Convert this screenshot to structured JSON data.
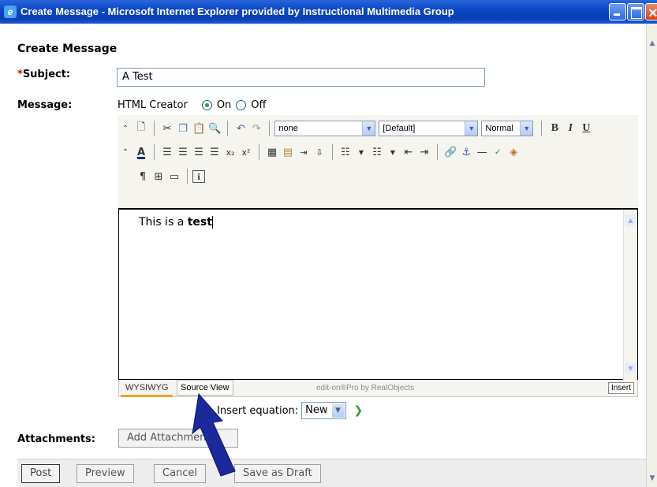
{
  "window": {
    "title": "Create Message - Microsoft Internet Explorer provided by Instructional Multimedia Group"
  },
  "form": {
    "heading": "Create Message",
    "subject_required_mark": "*",
    "subject_label": "Subject:",
    "subject_value": "A Test",
    "message_label": "Message:",
    "html_creator_label": "HTML Creator",
    "on_label": "On",
    "off_label": "Off",
    "html_creator_on": true
  },
  "toolbar": {
    "style_select": "none",
    "font_select": "[Default]",
    "size_select": "Normal",
    "bold": "B",
    "italic": "I",
    "underline": "U"
  },
  "editor": {
    "text_normal": "This is a ",
    "text_bold": "test",
    "tab_wysiwyg": "WYSIWYG",
    "tab_source": "Source View",
    "brand": "edit-on®Pro by RealObjects",
    "insert_mode": "Insert"
  },
  "equation": {
    "label": "Insert equation:",
    "value": "New"
  },
  "attachments": {
    "label": "Attachments:",
    "button": "Add Attachment"
  },
  "buttons": {
    "post": "Post",
    "preview": "Preview",
    "cancel": "Cancel",
    "save_draft": "Save as Draft"
  },
  "colors": {
    "title_bar": "#0b47c6",
    "pointer_arrow": "#1a2a9c"
  }
}
